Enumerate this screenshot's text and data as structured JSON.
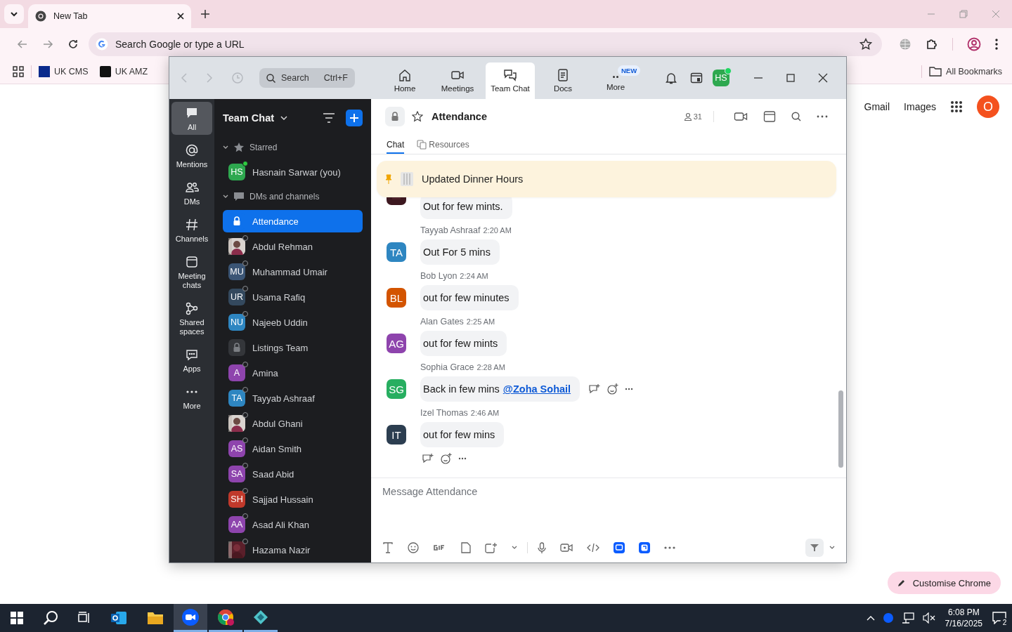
{
  "browser": {
    "tab_title": "New Tab",
    "omnibox_placeholder": "Search Google or type a URL",
    "bookmarks": [
      "UK CMS",
      "UK AMZ"
    ],
    "all_bookmarks": "All Bookmarks"
  },
  "new_tab_page": {
    "links": [
      "Gmail",
      "Images"
    ],
    "avatar": "O",
    "customise_button": "Customise Chrome"
  },
  "zoom": {
    "search": {
      "placeholder": "Search",
      "shortcut": "Ctrl+F"
    },
    "nav_tabs": [
      {
        "label": "Home",
        "selected": false
      },
      {
        "label": "Meetings",
        "selected": false
      },
      {
        "label": "Team Chat",
        "selected": true
      },
      {
        "label": "Docs",
        "selected": false
      },
      {
        "label": "More",
        "selected": false,
        "badge": "NEW"
      }
    ],
    "user_avatar": "HS",
    "rail": [
      {
        "label": "All",
        "selected": true
      },
      {
        "label": "Mentions",
        "selected": false
      },
      {
        "label": "DMs",
        "selected": false
      },
      {
        "label": "Channels",
        "selected": false
      },
      {
        "label": "Meeting chats",
        "selected": false
      },
      {
        "label": "Shared spaces",
        "selected": false
      },
      {
        "label": "Apps",
        "selected": false
      },
      {
        "label": "More",
        "selected": false
      }
    ],
    "sidebar": {
      "title": "Team Chat",
      "sections": [
        {
          "label": "Starred",
          "expanded": true,
          "items": [
            {
              "name": "Hasnain Sarwar (you)",
              "kind": "initials",
              "initials": "HS",
              "color": "#2ea84f",
              "online": true,
              "selected": false
            }
          ]
        },
        {
          "label": "DMs and channels",
          "expanded": true,
          "items": [
            {
              "name": "Attendance",
              "kind": "lock",
              "selected": true
            },
            {
              "name": "Abdul Rehman",
              "online": false,
              "selected": false
            },
            {
              "name": "Muhammad Umair",
              "kind": "initials",
              "initials": "MU",
              "color": "#3b5575",
              "online": false,
              "selected": false
            },
            {
              "name": "Usama Rafiq",
              "kind": "initials",
              "initials": "UR",
              "color": "#34495e",
              "online": false,
              "selected": false
            },
            {
              "name": "Najeeb Uddin",
              "kind": "initials",
              "initials": "NU",
              "color": "#2e86c1",
              "online": false,
              "selected": false
            },
            {
              "name": "Listings Team",
              "kind": "lock",
              "selected": false
            },
            {
              "name": "Amina",
              "kind": "initials",
              "initials": "A",
              "color": "#8e44ad",
              "online": false,
              "selected": false
            },
            {
              "name": "Tayyab Ashraaf",
              "kind": "initials",
              "initials": "TA",
              "color": "#2e86c1",
              "online": false,
              "selected": false
            },
            {
              "name": "Abdul Ghani",
              "online": false,
              "selected": false
            },
            {
              "name": "Aidan Smith",
              "kind": "initials",
              "initials": "AS",
              "color": "#8e44ad",
              "online": false,
              "selected": false
            },
            {
              "name": "Saad Abid",
              "kind": "initials",
              "initials": "SA",
              "color": "#8e44ad",
              "online": false,
              "selected": false
            },
            {
              "name": "Sajjad Hussain",
              "kind": "initials",
              "initials": "SH",
              "color": "#c0392b",
              "online": false,
              "selected": false
            },
            {
              "name": "Asad Ali Khan",
              "kind": "initials",
              "initials": "AA",
              "color": "#8e44ad",
              "online": false,
              "selected": false
            },
            {
              "name": "Hazama Nazir",
              "online": false,
              "selected": false
            }
          ]
        }
      ]
    },
    "channel": {
      "title": "Attendance",
      "members": "31",
      "tabs": [
        {
          "label": "Chat",
          "selected": true
        },
        {
          "label": "Resources",
          "selected": false
        }
      ],
      "pinned": "Updated Dinner Hours",
      "messages": [
        {
          "text": "Out for few mints."
        },
        {
          "author": "Tayyab Ashraaf",
          "time": "2:20 AM",
          "kind": "initials",
          "initials": "TA",
          "color": "#2e86c1",
          "text": "Out For 5 mins"
        },
        {
          "author": "Bob Lyon",
          "time": "2:24 AM",
          "kind": "initials",
          "initials": "BL",
          "color": "#d35400",
          "text": "out for few minutes"
        },
        {
          "author": "Alan Gates",
          "time": "2:25 AM",
          "kind": "initials",
          "initials": "AG",
          "color": "#8e44ad",
          "text": "out for few mints"
        },
        {
          "author": "Sophia Grace",
          "time": "2:28 AM",
          "kind": "initials",
          "initials": "SG",
          "color": "#27ae60",
          "text": "Back in few mins",
          "mention": "@Zoha Sohail",
          "hovered": true
        },
        {
          "author": "Izel Thomas",
          "time": "2:46 AM",
          "kind": "initials",
          "initials": "IT",
          "color": "#2c3e50",
          "text": "out for few mins",
          "hovered": false,
          "reaction_bar": true
        }
      ],
      "composer": {
        "placeholder": "Message Attendance"
      }
    }
  },
  "taskbar": {
    "time": "6:08 PM",
    "date": "7/16/2025",
    "notifications": "2"
  }
}
